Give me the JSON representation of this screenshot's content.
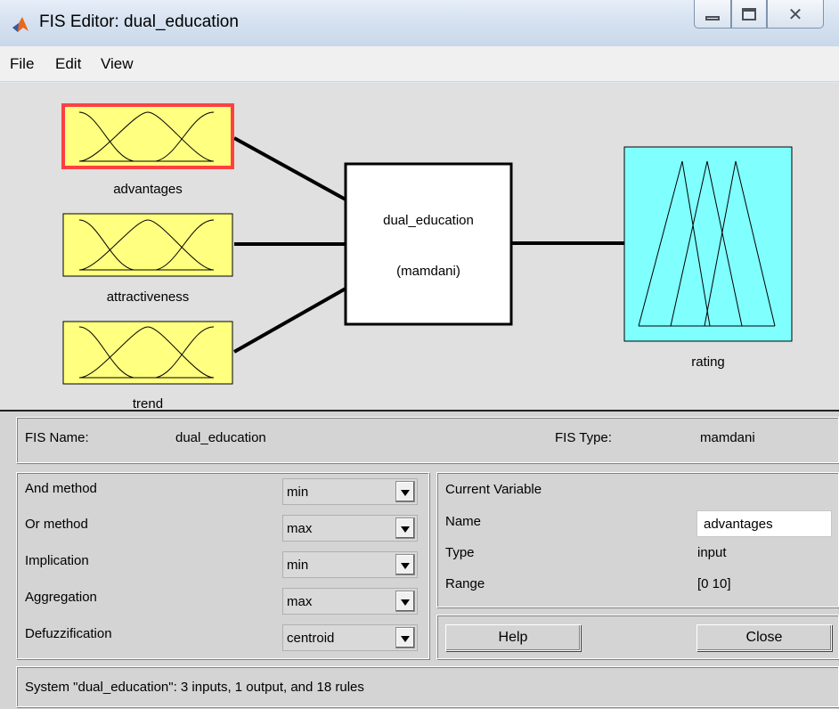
{
  "window": {
    "title": "FIS Editor: dual_education",
    "icon": "matlab-icon"
  },
  "menu": {
    "items": [
      "File",
      "Edit",
      "View"
    ]
  },
  "diagram": {
    "inputs": [
      {
        "name": "advantages",
        "selected": true
      },
      {
        "name": "attractiveness",
        "selected": false
      },
      {
        "name": "trend",
        "selected": false
      }
    ],
    "system_name": "dual_education",
    "system_type": "(mamdani)",
    "output": {
      "name": "rating"
    }
  },
  "info": {
    "fis_name_label": "FIS Name:",
    "fis_name_value": "dual_education",
    "fis_type_label": "FIS Type:",
    "fis_type_value": "mamdani"
  },
  "methods": [
    {
      "label": "And method",
      "value": "min"
    },
    {
      "label": "Or method",
      "value": "max"
    },
    {
      "label": "Implication",
      "value": "min"
    },
    {
      "label": "Aggregation",
      "value": "max"
    },
    {
      "label": "Defuzzification",
      "value": "centroid"
    }
  ],
  "current_variable": {
    "title": "Current Variable",
    "name_label": "Name",
    "name_value": "advantages",
    "type_label": "Type",
    "type_value": "input",
    "range_label": "Range",
    "range_value": "[0 10]"
  },
  "buttons": {
    "help": "Help",
    "close": "Close"
  },
  "status": "System \"dual_education\": 3 inputs, 1 output, and 18 rules",
  "colors": {
    "input_fill": "#ffff80",
    "output_fill": "#80ffff",
    "selected_border": "#ff4040",
    "panel_bg": "#d4d4d4"
  }
}
